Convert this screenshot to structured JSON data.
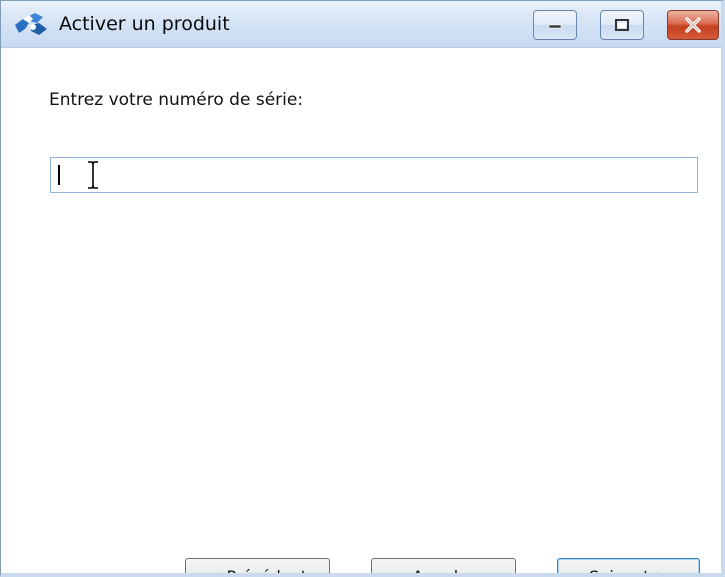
{
  "window": {
    "title": "Activer un produit",
    "icon": "puzzle-piece-icon",
    "controls": {
      "minimize": "minimize-icon",
      "maximize": "maximize-icon",
      "close": "close-icon"
    }
  },
  "form": {
    "prompt": "Entrez votre numéro de série:",
    "serial_value": ""
  },
  "buttons": {
    "previous": "< Précédant",
    "cancel": "Annuler",
    "next": "Suivant >"
  },
  "colors": {
    "titlebar": "#d6e4f5",
    "close_button": "#c2401f",
    "input_border": "#8fb3d9",
    "default_button_border": "#3c7fb1"
  }
}
